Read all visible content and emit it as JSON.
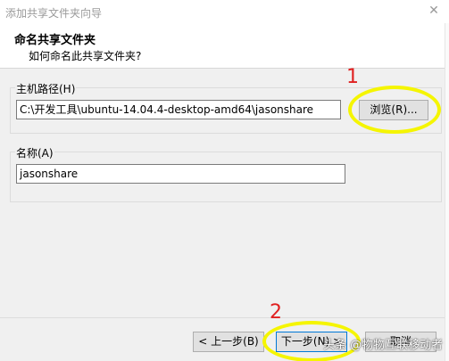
{
  "window": {
    "title": "添加共享文件夹向导",
    "close_glyph": "✕"
  },
  "header": {
    "heading": "命名共享文件夹",
    "subheading": "如何命名此共享文件夹?"
  },
  "host_path": {
    "label": "主机路径(H)",
    "value": "C:\\开发工具\\ubuntu-14.04.4-desktop-amd64\\jasonshare",
    "browse_label": "浏览(R)..."
  },
  "name": {
    "label": "名称(A)",
    "value": "jasonshare"
  },
  "footer": {
    "back_label": "< 上一步(B)",
    "next_label": "下一步(N) >",
    "cancel_label": "取消"
  },
  "annotations": {
    "marker_1": "1",
    "marker_2": "2",
    "highlight_color": "#f5f500",
    "marker_color": "#e02020"
  },
  "watermark": {
    "text": "头条 @物物互联移动者"
  }
}
